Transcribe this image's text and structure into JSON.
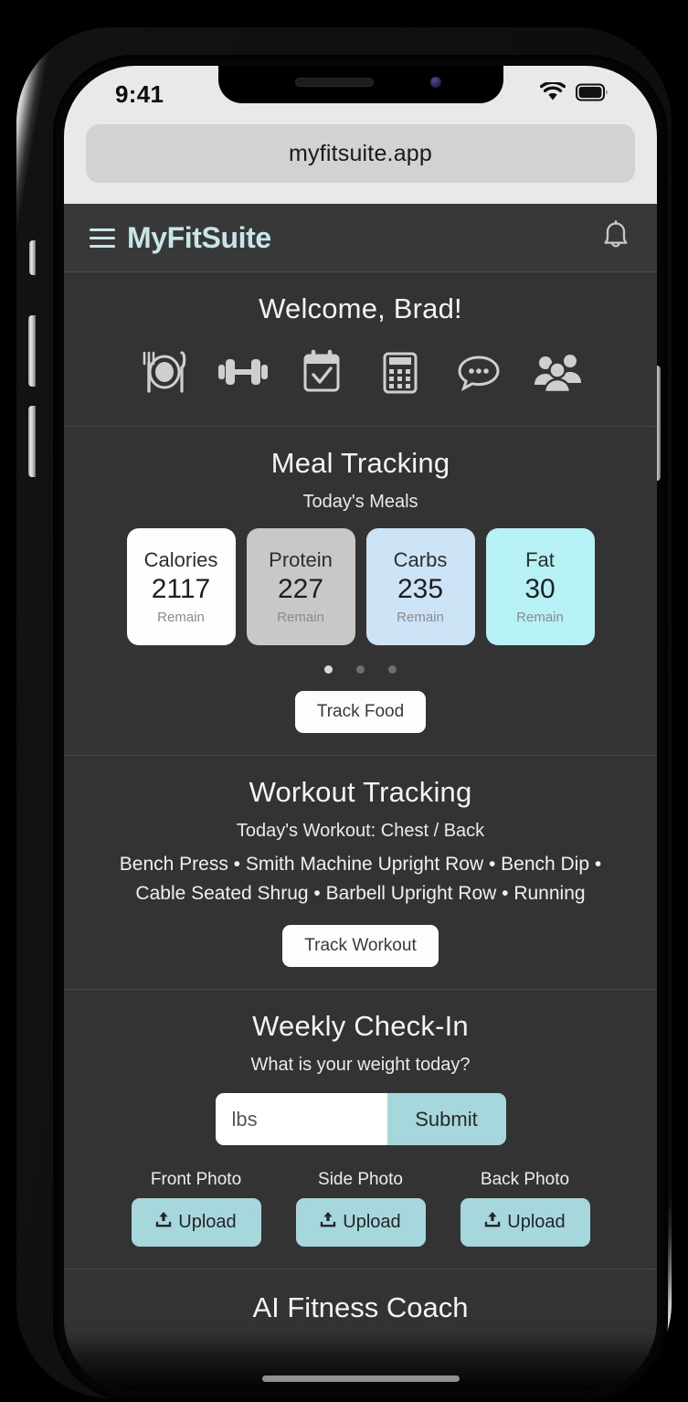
{
  "status_bar": {
    "time": "9:41",
    "wifi_icon": "wifi-icon",
    "battery_icon": "battery-full-icon"
  },
  "browser": {
    "url": "myfitsuite.app"
  },
  "app_header": {
    "menu_icon": "hamburger-menu-icon",
    "brand": "MyFitSuite",
    "notification_icon": "bell-icon"
  },
  "welcome": {
    "title": "Welcome, Brad!",
    "quicknav": [
      {
        "name": "meal-icon",
        "label": "Meals"
      },
      {
        "name": "dumbbell-icon",
        "label": "Workouts"
      },
      {
        "name": "calendar-check-icon",
        "label": "Calendar"
      },
      {
        "name": "calculator-icon",
        "label": "Calculator"
      },
      {
        "name": "chat-bubble-icon",
        "label": "Messages"
      },
      {
        "name": "people-group-icon",
        "label": "Community"
      }
    ]
  },
  "meal_tracking": {
    "title": "Meal Tracking",
    "subtitle": "Today's Meals",
    "macros": [
      {
        "label": "Calories",
        "value": "2117",
        "unit": "Remain",
        "color": "#fdfdfd"
      },
      {
        "label": "Protein",
        "value": "227",
        "unit": "Remain",
        "color": "#c8c8c6"
      },
      {
        "label": "Carbs",
        "value": "235",
        "unit": "Remain",
        "color": "#cce4f6"
      },
      {
        "label": "Fat",
        "value": "30",
        "unit": "Remain",
        "color": "#b6f2f5"
      }
    ],
    "carousel_dots": 3,
    "carousel_active_index": 0,
    "track_button": "Track Food"
  },
  "workout_tracking": {
    "title": "Workout Tracking",
    "today_label": "Today's Workout: Chest / Back",
    "exercises": "Bench Press • Smith Machine Upright Row • Bench Dip • Cable Seated Shrug • Barbell Upright Row • Running",
    "track_button": "Track Workout"
  },
  "weekly_checkin": {
    "title": "Weekly Check-In",
    "question": "What is your weight today?",
    "weight_value": "",
    "weight_placeholder": "lbs",
    "submit_label": "Submit",
    "photos": [
      {
        "label": "Front Photo",
        "button": "Upload",
        "icon": "upload-icon"
      },
      {
        "label": "Side Photo",
        "button": "Upload",
        "icon": "upload-icon"
      },
      {
        "label": "Back Photo",
        "button": "Upload",
        "icon": "upload-icon"
      }
    ]
  },
  "ai_coach": {
    "title": "AI Fitness Coach"
  },
  "theme": {
    "brand_color": "#c6e6e8",
    "accent_color": "#a6d7dd",
    "app_background": "#333333",
    "header_background": "#383838"
  }
}
